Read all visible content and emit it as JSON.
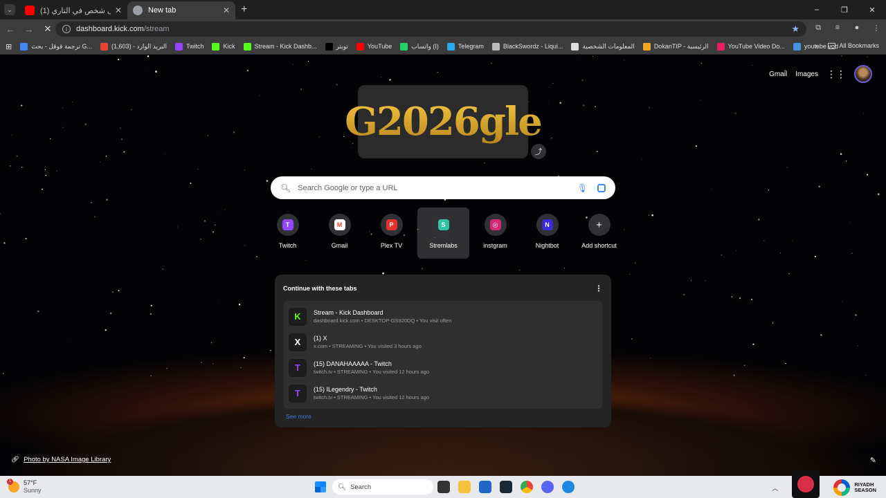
{
  "browser": {
    "tabs": [
      {
        "title": "(1) من هو اغنى شخص في التاري",
        "favicon_color": "#ff0000",
        "active": false
      },
      {
        "title": "New tab",
        "favicon_color": "#9aa0a6",
        "active": true
      }
    ],
    "new_tab_symbol": "+",
    "window_controls": [
      "–",
      "❐",
      "✕"
    ],
    "address": {
      "host": "dashboard.kick.com",
      "path": "/stream"
    },
    "bookmarks": [
      {
        "label": "ترجمة قوقل - بحث G...",
        "color": "#4285f4"
      },
      {
        "label": "البريد الوارد - (1,603)",
        "color": "#ea4335"
      },
      {
        "label": "Twitch",
        "color": "#9146ff"
      },
      {
        "label": "Kick",
        "color": "#53fc18"
      },
      {
        "label": "Stream - Kick Dashb...",
        "color": "#53fc18"
      },
      {
        "label": "تويتر",
        "color": "#000000"
      },
      {
        "label": "YouTube",
        "color": "#ff0000"
      },
      {
        "label": "واتساب (I)",
        "color": "#25d366"
      },
      {
        "label": "Telegram",
        "color": "#2aabee"
      },
      {
        "label": "BlackSwordz - Liqui...",
        "color": "#bbbbbb"
      },
      {
        "label": "المعلومات الشخصية",
        "color": "#dddddd"
      },
      {
        "label": "DokanTIP - الرئيسية",
        "color": "#f5a623"
      },
      {
        "label": "YouTube Video Do...",
        "color": "#e91e63"
      },
      {
        "label": "youtube vod",
        "color": "#4a90e2"
      }
    ],
    "all_bookmarks": "All Bookmarks"
  },
  "ntp": {
    "gmail": "Gmail",
    "images": "Images",
    "doodle_text": "G2026gle",
    "search_placeholder": "Search Google or type a URL",
    "shortcuts": [
      {
        "label": "Twitch",
        "letter": "T",
        "color": "#9146ff"
      },
      {
        "label": "Gmail",
        "letter": "M",
        "color": "#ea4335"
      },
      {
        "label": "Plex TV",
        "letter": "P",
        "color": "#e5322d"
      },
      {
        "label": "Stremlabs",
        "letter": "S",
        "color": "#31c3a2"
      },
      {
        "label": "instgram",
        "letter": "◎",
        "color": "#d62976"
      },
      {
        "label": "Nightbot",
        "letter": "N",
        "color": "#3b2bd6"
      },
      {
        "label": "Add shortcut",
        "letter": "+",
        "color": "#303134"
      }
    ],
    "continue": {
      "heading": "Continue with these tabs",
      "items": [
        {
          "title": "Stream - Kick Dashboard",
          "sub": "dashboard.kick.com • DESKTOP-GS920DQ • You visit often",
          "icon": "K",
          "color": "#53fc18"
        },
        {
          "title": "(1) X",
          "sub": "x.com • STREAMING • You visited 3 hours ago",
          "icon": "X",
          "color": "#ffffff"
        },
        {
          "title": "(15) DANAHAAAAA - Twitch",
          "sub": "twitch.tv • STREAMING • You visited 12 hours ago",
          "icon": "T",
          "color": "#9146ff"
        },
        {
          "title": "(15) ILegendry - Twitch",
          "sub": "twitch.tv • STREAMING • You visited 12 hours ago",
          "icon": "T",
          "color": "#9146ff"
        }
      ],
      "see_more": "See more"
    },
    "credit": "Photo by NASA Image Library"
  },
  "taskbar": {
    "weather": {
      "temp": "57°F",
      "condition": "Sunny",
      "badge": "1"
    },
    "search_label": "Search",
    "riyadh": [
      "RIYADH",
      "SEASON"
    ]
  }
}
